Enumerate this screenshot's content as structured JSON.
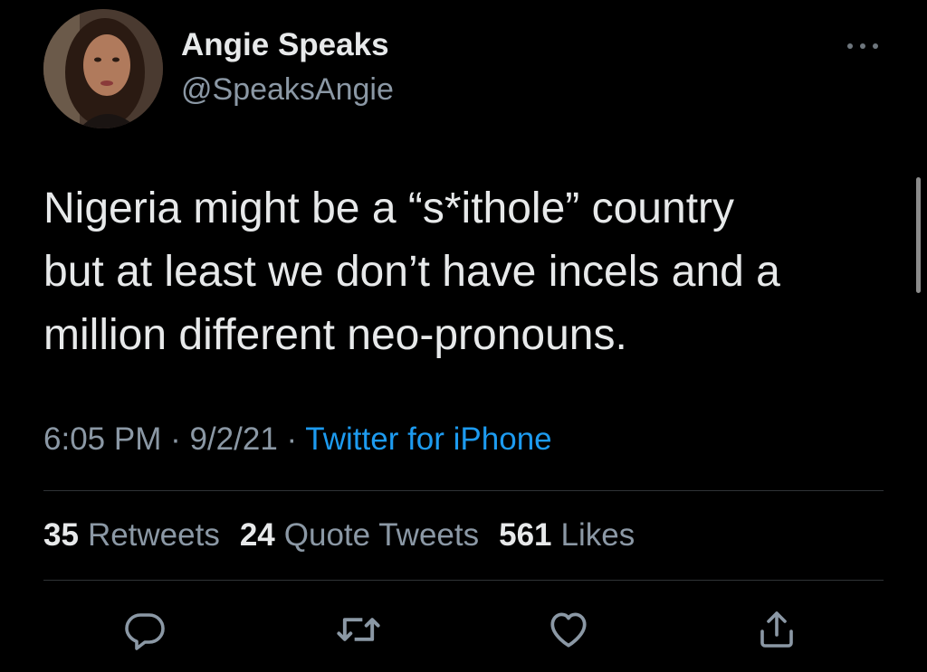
{
  "tweet": {
    "author": {
      "name": "Angie Speaks",
      "handle": "@SpeaksAngie"
    },
    "text_lines": [
      "Nigeria might be a “s*ithole” country",
      "but at least we don’t have incels and a",
      "million different neo-pronouns."
    ],
    "time": "6:05 PM",
    "date": "9/2/21",
    "separator": "·",
    "source": "Twitter for iPhone",
    "stats": {
      "retweets": {
        "count": "35",
        "label": "Retweets"
      },
      "quote_tweets": {
        "count": "24",
        "label": "Quote Tweets"
      },
      "likes": {
        "count": "561",
        "label": "Likes"
      }
    }
  },
  "icons": {
    "more": "more-horizontal-icon",
    "reply": "reply-icon",
    "retweet": "retweet-icon",
    "like": "heart-icon",
    "share": "share-icon"
  },
  "colors": {
    "background": "#000000",
    "primary_text": "#e7e9ea",
    "secondary_text": "#8b98a5",
    "link": "#1d9bf0",
    "divider": "#2f3336"
  }
}
